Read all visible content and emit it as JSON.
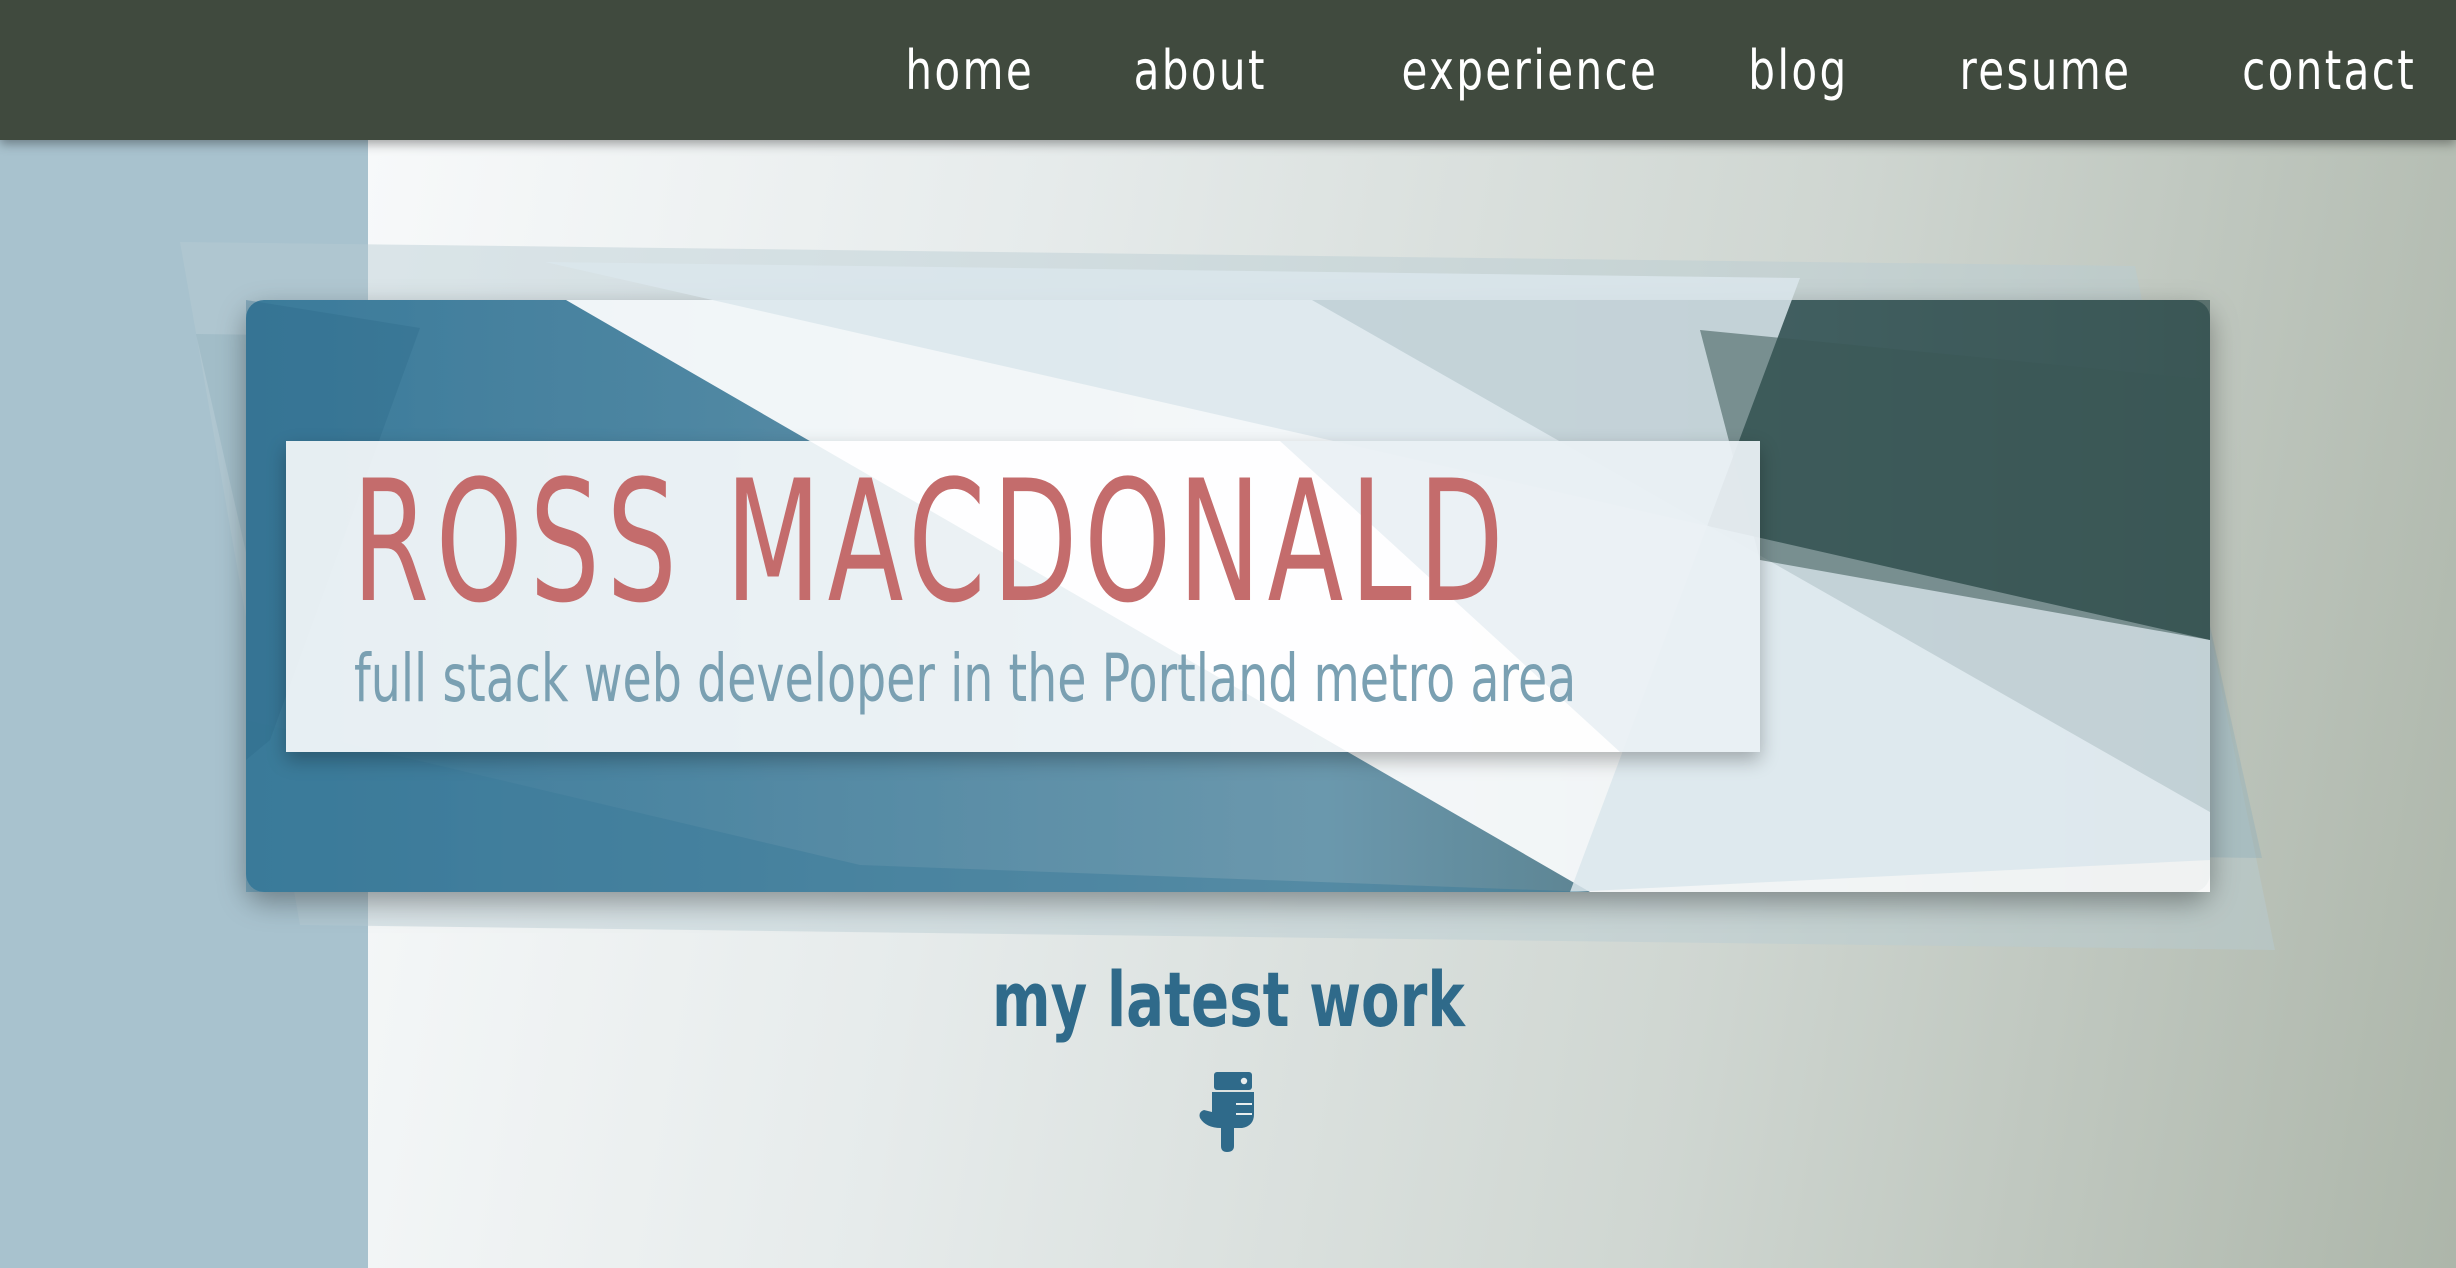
{
  "nav": {
    "items": [
      {
        "label": "home"
      },
      {
        "label": "about"
      },
      {
        "label": "experience"
      },
      {
        "label": "blog"
      },
      {
        "label": "resume"
      },
      {
        "label": "contact"
      }
    ]
  },
  "hero": {
    "name": "ROSS MACDONALD",
    "tagline": "full stack web developer in the Portland metro area"
  },
  "latest": {
    "heading": "my latest work",
    "icon": "pointing-down-hand-icon"
  },
  "colors": {
    "navbar": "#404a3e",
    "name": "#c46c6c",
    "tagline": "#7aa0b2",
    "accent_blue": "#2f6a8a",
    "dark_teal": "#3b5756"
  }
}
